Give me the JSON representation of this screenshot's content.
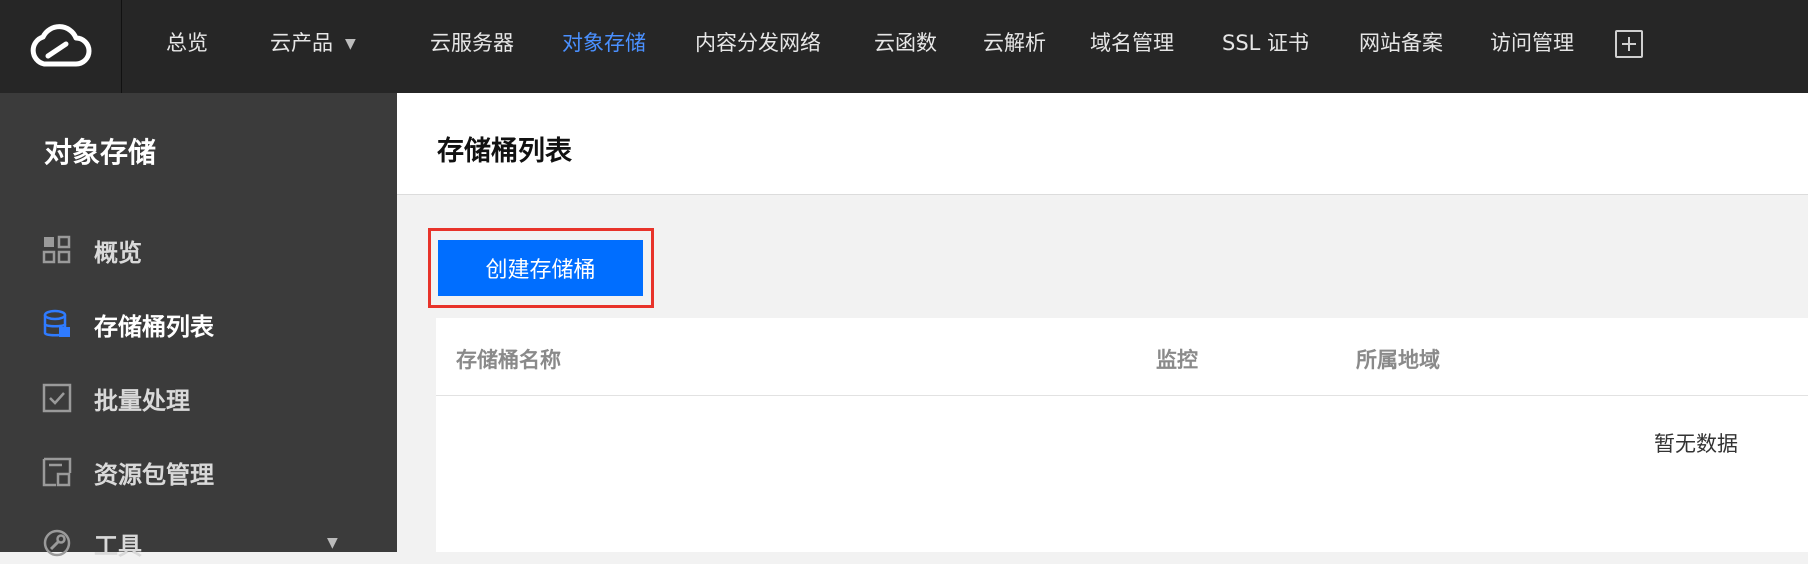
{
  "topnav": {
    "items": [
      {
        "label": "总览"
      },
      {
        "label": "云产品"
      },
      {
        "label": "云服务器"
      },
      {
        "label": "对象存储"
      },
      {
        "label": "内容分发网络"
      },
      {
        "label": "云函数"
      },
      {
        "label": "云解析"
      },
      {
        "label": "域名管理"
      },
      {
        "label": "SSL 证书"
      },
      {
        "label": "网站备案"
      },
      {
        "label": "访问管理"
      }
    ],
    "active": "对象存储",
    "icons": [
      "cloud-logo-icon",
      "caret-down-icon",
      "plus-box-icon"
    ]
  },
  "sidebar": {
    "title": "对象存储",
    "items": [
      {
        "label": "概览",
        "icon": "grid-icon"
      },
      {
        "label": "存储桶列表",
        "icon": "bucket-icon"
      },
      {
        "label": "批量处理",
        "icon": "checkbox-icon"
      },
      {
        "label": "资源包管理",
        "icon": "package-icon"
      },
      {
        "label": "工具",
        "icon": "tools-icon"
      }
    ],
    "active": "存储桶列表"
  },
  "main": {
    "title": "存储桶列表",
    "create_button": "创建存储桶",
    "table": {
      "columns": [
        "存储桶名称",
        "监控",
        "所属地域"
      ],
      "empty_text": "暂无数据"
    }
  },
  "colors": {
    "topbar_bg": "#262626",
    "sidebar_bg": "#3b3b3b",
    "accent": "#006eff",
    "active_nav": "#4a90ff",
    "highlight_border": "#e8332a"
  }
}
